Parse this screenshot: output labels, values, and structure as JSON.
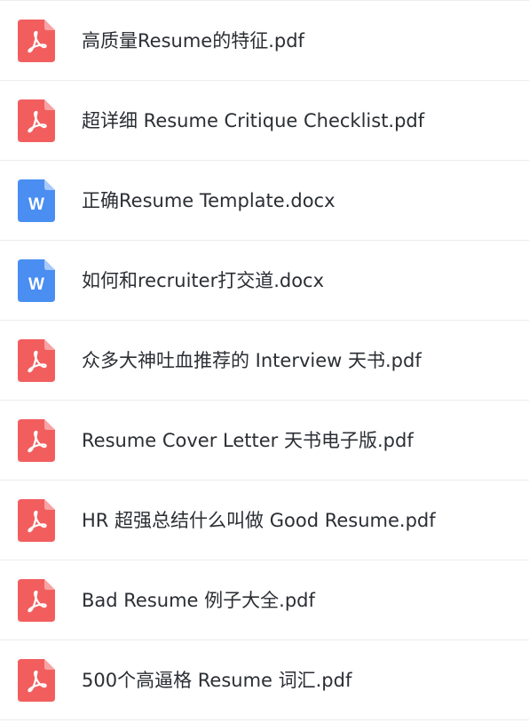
{
  "colors": {
    "pdf": "#f25e5e",
    "word": "#4a8ef2",
    "text": "#2b2e33",
    "divider": "#ececec"
  },
  "files": [
    {
      "name": "高质量Resume的特征.pdf",
      "type": "pdf",
      "icon": "pdf-icon"
    },
    {
      "name": "超详细 Resume Critique Checklist.pdf",
      "type": "pdf",
      "icon": "pdf-icon"
    },
    {
      "name": "正确Resume Template.docx",
      "type": "docx",
      "icon": "word-icon",
      "glyph": "W"
    },
    {
      "name": "如何和recruiter打交道.docx",
      "type": "docx",
      "icon": "word-icon",
      "glyph": "W"
    },
    {
      "name": "众多大神吐血推荐的 Interview 天书.pdf",
      "type": "pdf",
      "icon": "pdf-icon"
    },
    {
      "name": "Resume Cover Letter 天书电子版.pdf",
      "type": "pdf",
      "icon": "pdf-icon"
    },
    {
      "name": "HR 超强总结什么叫做 Good Resume.pdf",
      "type": "pdf",
      "icon": "pdf-icon"
    },
    {
      "name": "Bad Resume 例子大全.pdf",
      "type": "pdf",
      "icon": "pdf-icon"
    },
    {
      "name": "500个高逼格 Resume 词汇.pdf",
      "type": "pdf",
      "icon": "pdf-icon"
    }
  ]
}
